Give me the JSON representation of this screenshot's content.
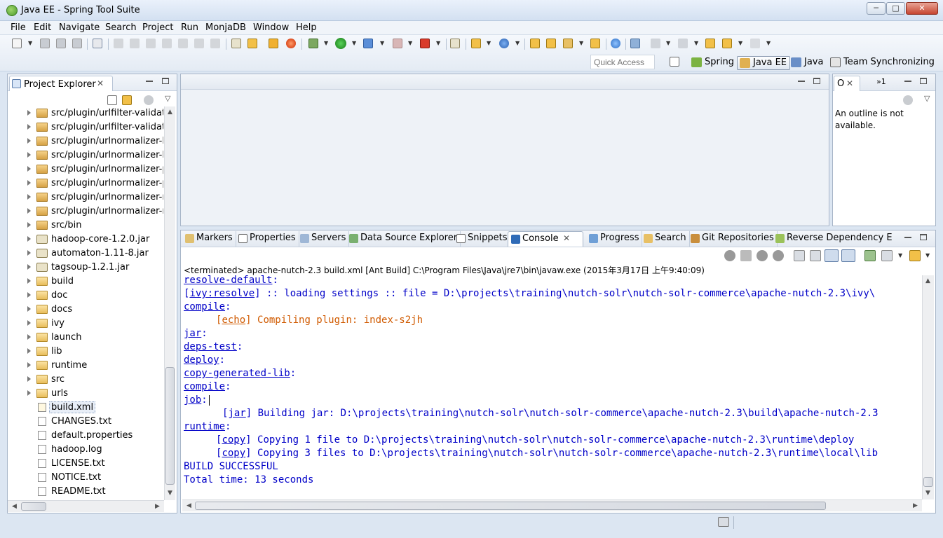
{
  "window": {
    "title": "Java EE - Spring Tool Suite"
  },
  "menu": [
    "File",
    "Edit",
    "Navigate",
    "Search",
    "Project",
    "Run",
    "MonjaDB",
    "Window",
    "Help"
  ],
  "toolbar": {
    "quick_access_placeholder": "Quick Access",
    "perspectives": [
      {
        "label": "Spring",
        "icon": "spring-leaf-icon"
      },
      {
        "label": "Java EE",
        "icon": "java-ee-icon",
        "active": true
      },
      {
        "label": "Java",
        "icon": "java-icon"
      },
      {
        "label": "Team Synchronizing",
        "icon": "team-sync-icon"
      }
    ]
  },
  "project_explorer": {
    "title": "Project Explorer",
    "items": [
      {
        "label": "src/plugin/urlfilter-validator",
        "icon": "package-folder-icon",
        "expandable": true
      },
      {
        "label": "src/plugin/urlfilter-validator",
        "icon": "package-folder-icon",
        "expandable": true
      },
      {
        "label": "src/plugin/urlnormalizer-ba",
        "icon": "package-folder-icon",
        "expandable": true
      },
      {
        "label": "src/plugin/urlnormalizer-ba",
        "icon": "package-folder-icon",
        "expandable": true
      },
      {
        "label": "src/plugin/urlnormalizer-pa",
        "icon": "package-folder-icon",
        "expandable": true
      },
      {
        "label": "src/plugin/urlnormalizer-pa",
        "icon": "package-folder-icon",
        "expandable": true
      },
      {
        "label": "src/plugin/urlnormalizer-re",
        "icon": "package-folder-icon",
        "expandable": true
      },
      {
        "label": "src/plugin/urlnormalizer-re",
        "icon": "package-folder-icon",
        "expandable": true
      },
      {
        "label": "src/bin",
        "icon": "package-folder-icon",
        "expandable": true
      },
      {
        "label": "hadoop-core-1.2.0.jar",
        "icon": "jar-icon",
        "expandable": true
      },
      {
        "label": "automaton-1.11-8.jar",
        "icon": "jar-icon",
        "expandable": true
      },
      {
        "label": "tagsoup-1.2.1.jar",
        "icon": "jar-icon",
        "expandable": true
      },
      {
        "label": "build",
        "icon": "folder-icon",
        "expandable": true
      },
      {
        "label": "doc",
        "icon": "folder-icon",
        "expandable": true
      },
      {
        "label": "docs",
        "icon": "folder-icon",
        "expandable": true
      },
      {
        "label": "ivy",
        "icon": "folder-icon",
        "expandable": true
      },
      {
        "label": "launch",
        "icon": "folder-icon",
        "expandable": true
      },
      {
        "label": "lib",
        "icon": "folder-icon",
        "expandable": true
      },
      {
        "label": "runtime",
        "icon": "folder-icon",
        "expandable": true
      },
      {
        "label": "src",
        "icon": "folder-icon",
        "expandable": true
      },
      {
        "label": "urls",
        "icon": "folder-icon",
        "expandable": true
      },
      {
        "label": "build.xml",
        "icon": "ant-xml-icon",
        "expandable": false,
        "selected": true
      },
      {
        "label": "CHANGES.txt",
        "icon": "text-file-icon",
        "expandable": false
      },
      {
        "label": "default.properties",
        "icon": "text-file-icon",
        "expandable": false
      },
      {
        "label": "hadoop.log",
        "icon": "text-file-icon",
        "expandable": false
      },
      {
        "label": "LICENSE.txt",
        "icon": "text-file-icon",
        "expandable": false
      },
      {
        "label": "NOTICE.txt",
        "icon": "text-file-icon",
        "expandable": false
      },
      {
        "label": "README.txt",
        "icon": "text-file-icon",
        "expandable": false
      }
    ]
  },
  "outline": {
    "tab_label": "O",
    "overflow_label": "»1",
    "message": "An outline is not available."
  },
  "bottom_tabs": [
    {
      "label": "Markers",
      "icon": "markers-icon"
    },
    {
      "label": "Properties",
      "icon": "properties-icon"
    },
    {
      "label": "Servers",
      "icon": "servers-icon"
    },
    {
      "label": "Data Source Explorer",
      "icon": "data-source-icon"
    },
    {
      "label": "Snippets",
      "icon": "snippets-icon"
    },
    {
      "label": "Console",
      "icon": "console-icon",
      "active": true
    },
    {
      "label": "Progress",
      "icon": "progress-icon"
    },
    {
      "label": "Search",
      "icon": "search-icon"
    },
    {
      "label": "Git Repositories",
      "icon": "git-icon"
    },
    {
      "label": "Reverse Dependency E",
      "icon": "ivy-icon"
    }
  ],
  "console": {
    "header": "<terminated> apache-nutch-2.3 build.xml [Ant Build] C:\\Program Files\\Java\\jre7\\bin\\javaw.exe (2015年3月17日 上午9:40:09)",
    "lines": [
      {
        "indent": 0,
        "link": "resolve-default",
        "rest": ":",
        "color": "blue"
      },
      {
        "indent": 0,
        "pre": "[",
        "link": "ivy:resolve",
        "rest": "] :: loading settings :: file = D:\\projects\\training\\nutch-solr\\nutch-solr-commerce\\apache-nutch-2.3\\ivy\\",
        "color": "blue"
      },
      {
        "indent": 0,
        "link": "compile",
        "rest": ":",
        "color": "blue"
      },
      {
        "indent": 1,
        "pre": "[",
        "link": "echo",
        "rest": "] Compiling plugin: index-s2jh",
        "color": "orange"
      },
      {
        "indent": 0,
        "link": "jar",
        "rest": ":",
        "color": "blue"
      },
      {
        "indent": 0,
        "link": "deps-test",
        "rest": ":",
        "color": "blue"
      },
      {
        "indent": 0,
        "link": "deploy",
        "rest": ":",
        "color": "blue"
      },
      {
        "indent": 0,
        "link": "copy-generated-lib",
        "rest": ":",
        "color": "blue"
      },
      {
        "indent": 0,
        "link": "compile",
        "rest": ":",
        "color": "blue"
      },
      {
        "indent": 0,
        "link": "job",
        "rest": ":",
        "color": "blue"
      },
      {
        "indent": 2,
        "pre": "[",
        "link": "jar",
        "rest": "] Building jar: D:\\projects\\training\\nutch-solr\\nutch-solr-commerce\\apache-nutch-2.3\\build\\apache-nutch-2.3",
        "color": "blue"
      },
      {
        "indent": 0,
        "link": "runtime",
        "rest": ":",
        "color": "blue"
      },
      {
        "indent": 1,
        "pre": "[",
        "link": "copy",
        "rest": "] Copying 1 file to D:\\projects\\training\\nutch-solr\\nutch-solr-commerce\\apache-nutch-2.3\\runtime\\deploy",
        "color": "blue"
      },
      {
        "indent": 1,
        "pre": "[",
        "link": "copy",
        "rest": "] Copying 3 files to D:\\projects\\training\\nutch-solr\\nutch-solr-commerce\\apache-nutch-2.3\\runtime\\local\\lib",
        "color": "blue"
      },
      {
        "indent": 0,
        "text": "BUILD SUCCESSFUL",
        "color": "blue"
      },
      {
        "indent": 0,
        "text": "Total time: 13 seconds",
        "color": "blue"
      }
    ]
  },
  "colors": {
    "window_bg": "#dce6f2",
    "console_text": "#0000c8",
    "console_echo": "#d05a00"
  }
}
